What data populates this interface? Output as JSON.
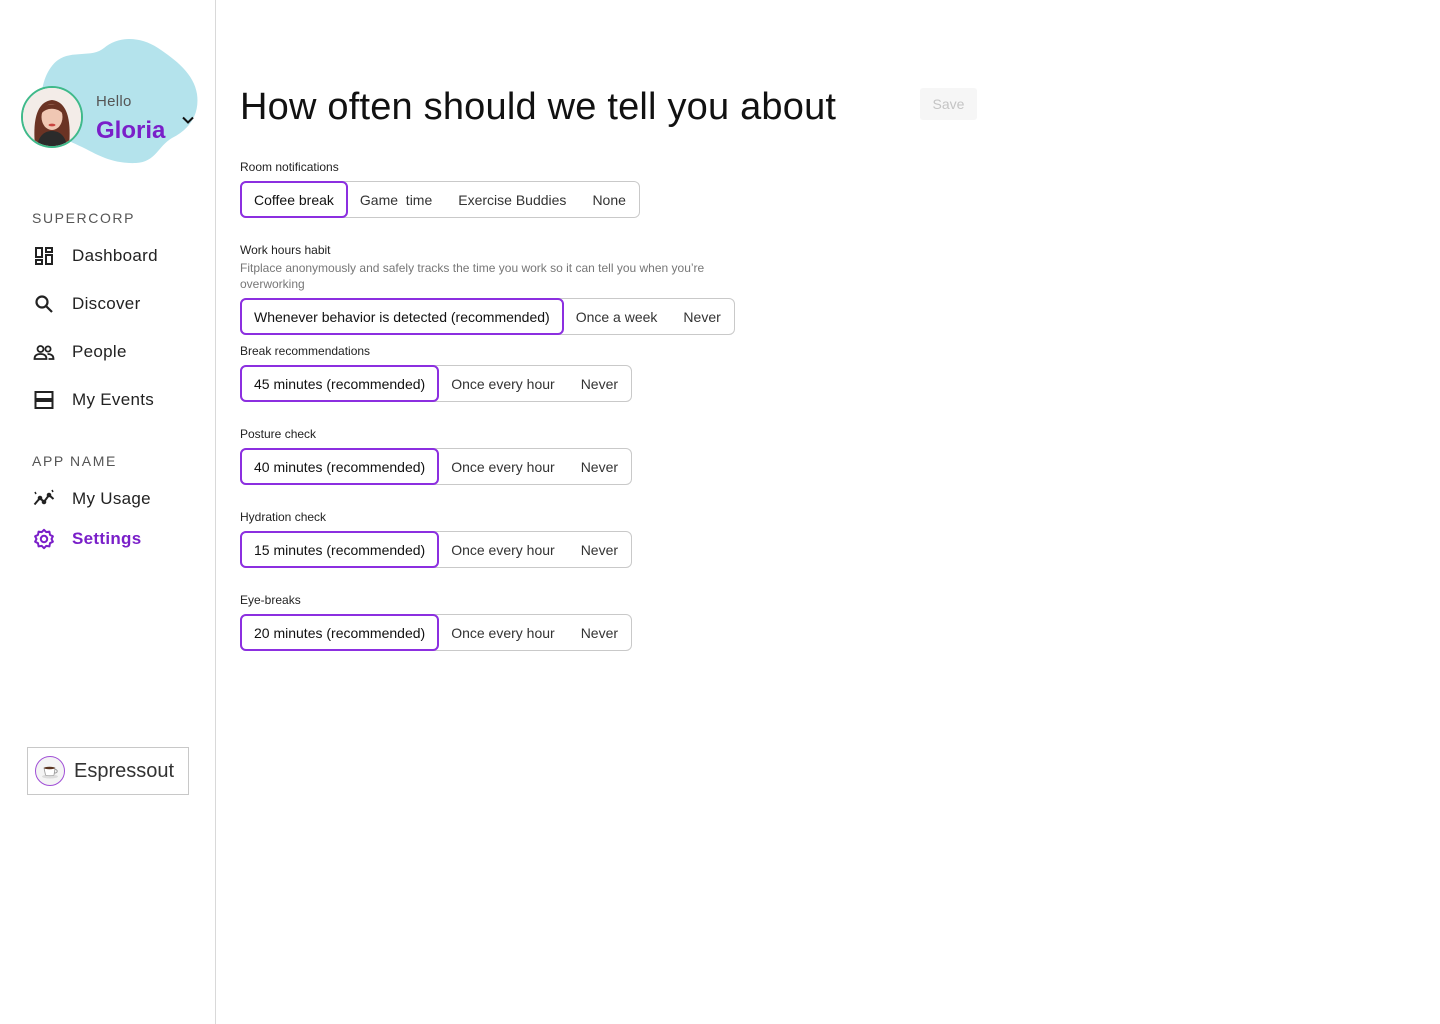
{
  "user": {
    "greeting": "Hello",
    "name": "Gloria"
  },
  "colors": {
    "accent": "#7a1fc9",
    "selected_border": "#8c2fe0",
    "blob": "#b4e3ec",
    "avatar_ring": "#3fb98a"
  },
  "sidebar": {
    "sections": [
      {
        "label": "SUPERCORP",
        "items": [
          {
            "label": "Dashboard",
            "icon": "dashboard-icon"
          },
          {
            "label": "Discover",
            "icon": "search-icon"
          },
          {
            "label": "People",
            "icon": "people-icon"
          },
          {
            "label": "My Events",
            "icon": "events-icon"
          }
        ]
      },
      {
        "label": "APP NAME",
        "items": [
          {
            "label": "My Usage",
            "icon": "usage-chart-icon"
          },
          {
            "label": "Settings",
            "icon": "gear-icon",
            "active": true
          }
        ]
      }
    ],
    "workspace": {
      "label": "Espressout",
      "icon": "coffee-cup-icon"
    }
  },
  "main": {
    "title": "How often should we tell you about",
    "save_label": "Save",
    "save_disabled": true,
    "groups": [
      {
        "label": "Room notifications",
        "options": [
          "Coffee break",
          "Game  time",
          "Exercise Buddies",
          "None"
        ],
        "selected": 0
      },
      {
        "label": "Work hours habit",
        "description": "Fitplace anonymously and safely tracks the time you work so it can tell you when you’re overworking",
        "options": [
          "Whenever behavior is detected (recommended)",
          "Once a week",
          "Never"
        ],
        "selected": 0
      },
      {
        "label": "Break recommendations",
        "options": [
          "45 minutes (recommended)",
          "Once every hour",
          "Never"
        ],
        "selected": 0
      },
      {
        "label": "Posture check",
        "options": [
          "40 minutes (recommended)",
          "Once every hour",
          "Never"
        ],
        "selected": 0
      },
      {
        "label": "Hydration check",
        "options": [
          "15 minutes (recommended)",
          "Once every hour",
          "Never"
        ],
        "selected": 0
      },
      {
        "label": "Eye-breaks",
        "options": [
          "20 minutes (recommended)",
          "Once every hour",
          "Never"
        ],
        "selected": 0
      }
    ]
  }
}
